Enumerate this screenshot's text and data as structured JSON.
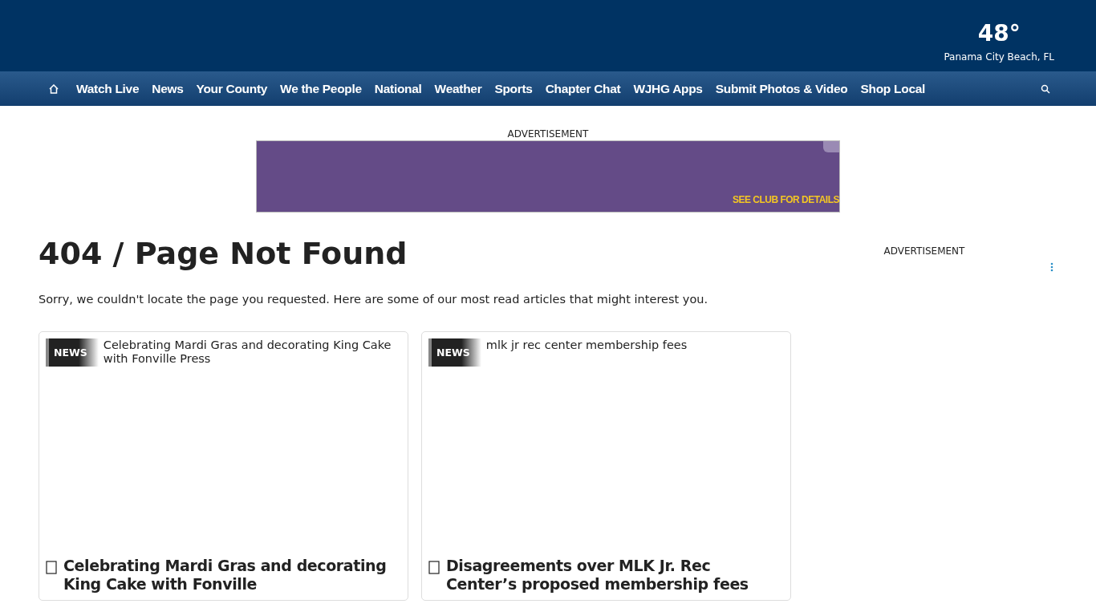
{
  "header": {
    "temperature": "48°",
    "location": "Panama City Beach, FL"
  },
  "nav": {
    "items": [
      {
        "label": "Watch Live"
      },
      {
        "label": "News"
      },
      {
        "label": "Your County"
      },
      {
        "label": "We the People"
      },
      {
        "label": "National"
      },
      {
        "label": "Weather"
      },
      {
        "label": "Sports"
      },
      {
        "label": "Chapter Chat"
      },
      {
        "label": "WJHG Apps"
      },
      {
        "label": "Submit Photos & Video"
      },
      {
        "label": "Shop Local"
      }
    ]
  },
  "top_ad": {
    "label": "ADVERTISEMENT",
    "banner_text": "SEE CLUB FOR DETAILS"
  },
  "page": {
    "title": "404 / Page Not Found",
    "message": "Sorry, we couldn't locate the page you requested. Here are some of our most read articles that might interest you."
  },
  "side_ad": {
    "label": "ADVERTISEMENT"
  },
  "articles": [
    {
      "badge": "NEWS",
      "image_alt": "Celebrating Mardi Gras and decorating King Cake with Fonville Press",
      "headline": "Celebrating Mardi Gras and decorating King Cake with Fonville"
    },
    {
      "badge": "NEWS",
      "image_alt": "mlk jr rec center membership fees",
      "headline": "Disagreements over MLK Jr. Rec Center’s proposed membership fees"
    }
  ]
}
